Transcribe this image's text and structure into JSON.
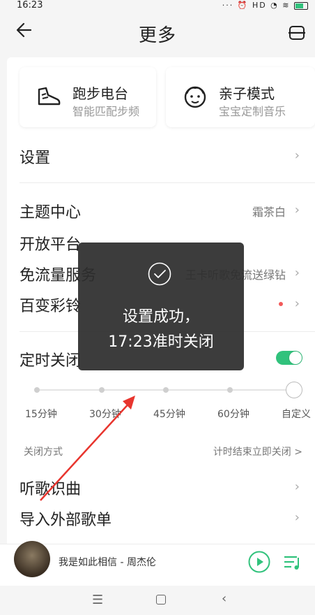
{
  "status": {
    "time": "16:23",
    "icons": "··· ⏰ HD ◔ ≋"
  },
  "header": {
    "title": "更多"
  },
  "cards": [
    {
      "title": "跑步电台",
      "subtitle": "智能匹配步频",
      "icon": "running-shoe-icon"
    },
    {
      "title": "亲子模式",
      "subtitle": "宝宝定制音乐",
      "icon": "baby-face-icon"
    }
  ],
  "rows": {
    "settings": {
      "label": "设置"
    },
    "theme": {
      "label": "主题中心",
      "value": "霜茶白"
    },
    "open": {
      "label": "开放平台"
    },
    "free": {
      "label": "免流量服务",
      "value": "王卡听歌免流送绿钻"
    },
    "ring": {
      "label": "百变彩铃"
    },
    "timer": {
      "label": "定时关闭",
      "enabled": true
    }
  },
  "timer_options": [
    "15分钟",
    "30分钟",
    "45分钟",
    "60分钟",
    "自定义"
  ],
  "closing": {
    "label": "关闭方式",
    "value": "计时结束立即关闭 >"
  },
  "more_rows": {
    "identify": "听歌识曲",
    "import": "导入外部歌单"
  },
  "toast": {
    "line1": "设置成功，",
    "line2": "17:23准时关闭"
  },
  "player": {
    "song": "我是如此相信 - 周杰伦"
  },
  "colors": {
    "accent": "#31c27c",
    "toast_bg": "#2d2d2d",
    "arrow": "#e8352e",
    "dot": "#f25a5a"
  }
}
